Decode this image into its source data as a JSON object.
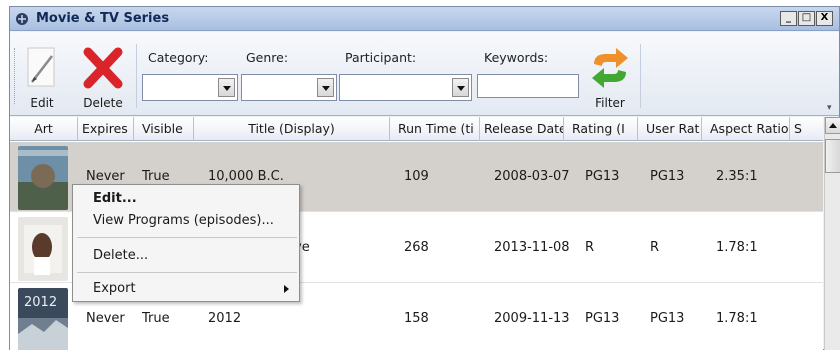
{
  "window": {
    "title": "Movie & TV Series",
    "controls": [
      "_",
      "□",
      "X"
    ]
  },
  "toolbar": {
    "edit_label": "Edit",
    "delete_label": "Delete",
    "filter_label": "Filter",
    "category_label": "Category:",
    "genre_label": "Genre:",
    "participant_label": "Participant:",
    "keywords_label": "Keywords:",
    "category_value": "",
    "genre_value": "",
    "participant_value": "",
    "keywords_value": ""
  },
  "grid": {
    "columns": [
      "Art",
      "Expires",
      "Visible",
      "Title (Display)",
      "Run Time (ti",
      "Release Date",
      "Rating (I",
      "User Rat",
      "Aspect Ratio",
      "S"
    ],
    "rows": [
      {
        "expires": "Never",
        "visible": "True",
        "title": "10,000 B.C.",
        "runtime": "109",
        "release": "2008-03-07",
        "rating": "PG13",
        "user_rating": "PG13",
        "aspect": "2.35:1",
        "selected": true
      },
      {
        "expires": "",
        "visible": "",
        "title": "ve",
        "runtime": "268",
        "release": "2013-11-08",
        "rating": "R",
        "user_rating": "R",
        "aspect": "1.78:1",
        "selected": false
      },
      {
        "expires": "Never",
        "visible": "True",
        "title": "2012",
        "runtime": "158",
        "release": "2009-11-13",
        "rating": "PG13",
        "user_rating": "PG13",
        "aspect": "1.78:1",
        "selected": false
      }
    ]
  },
  "context_menu": {
    "items": [
      "Edit...",
      "View Programs (episodes)...",
      "Delete...",
      "Export"
    ]
  },
  "colors": {
    "selected_row": "#d4d0cb",
    "titlebar": "#b9cbe8",
    "delete_red": "#d9252a",
    "filter_green": "#43a832",
    "filter_orange": "#f0902a"
  }
}
